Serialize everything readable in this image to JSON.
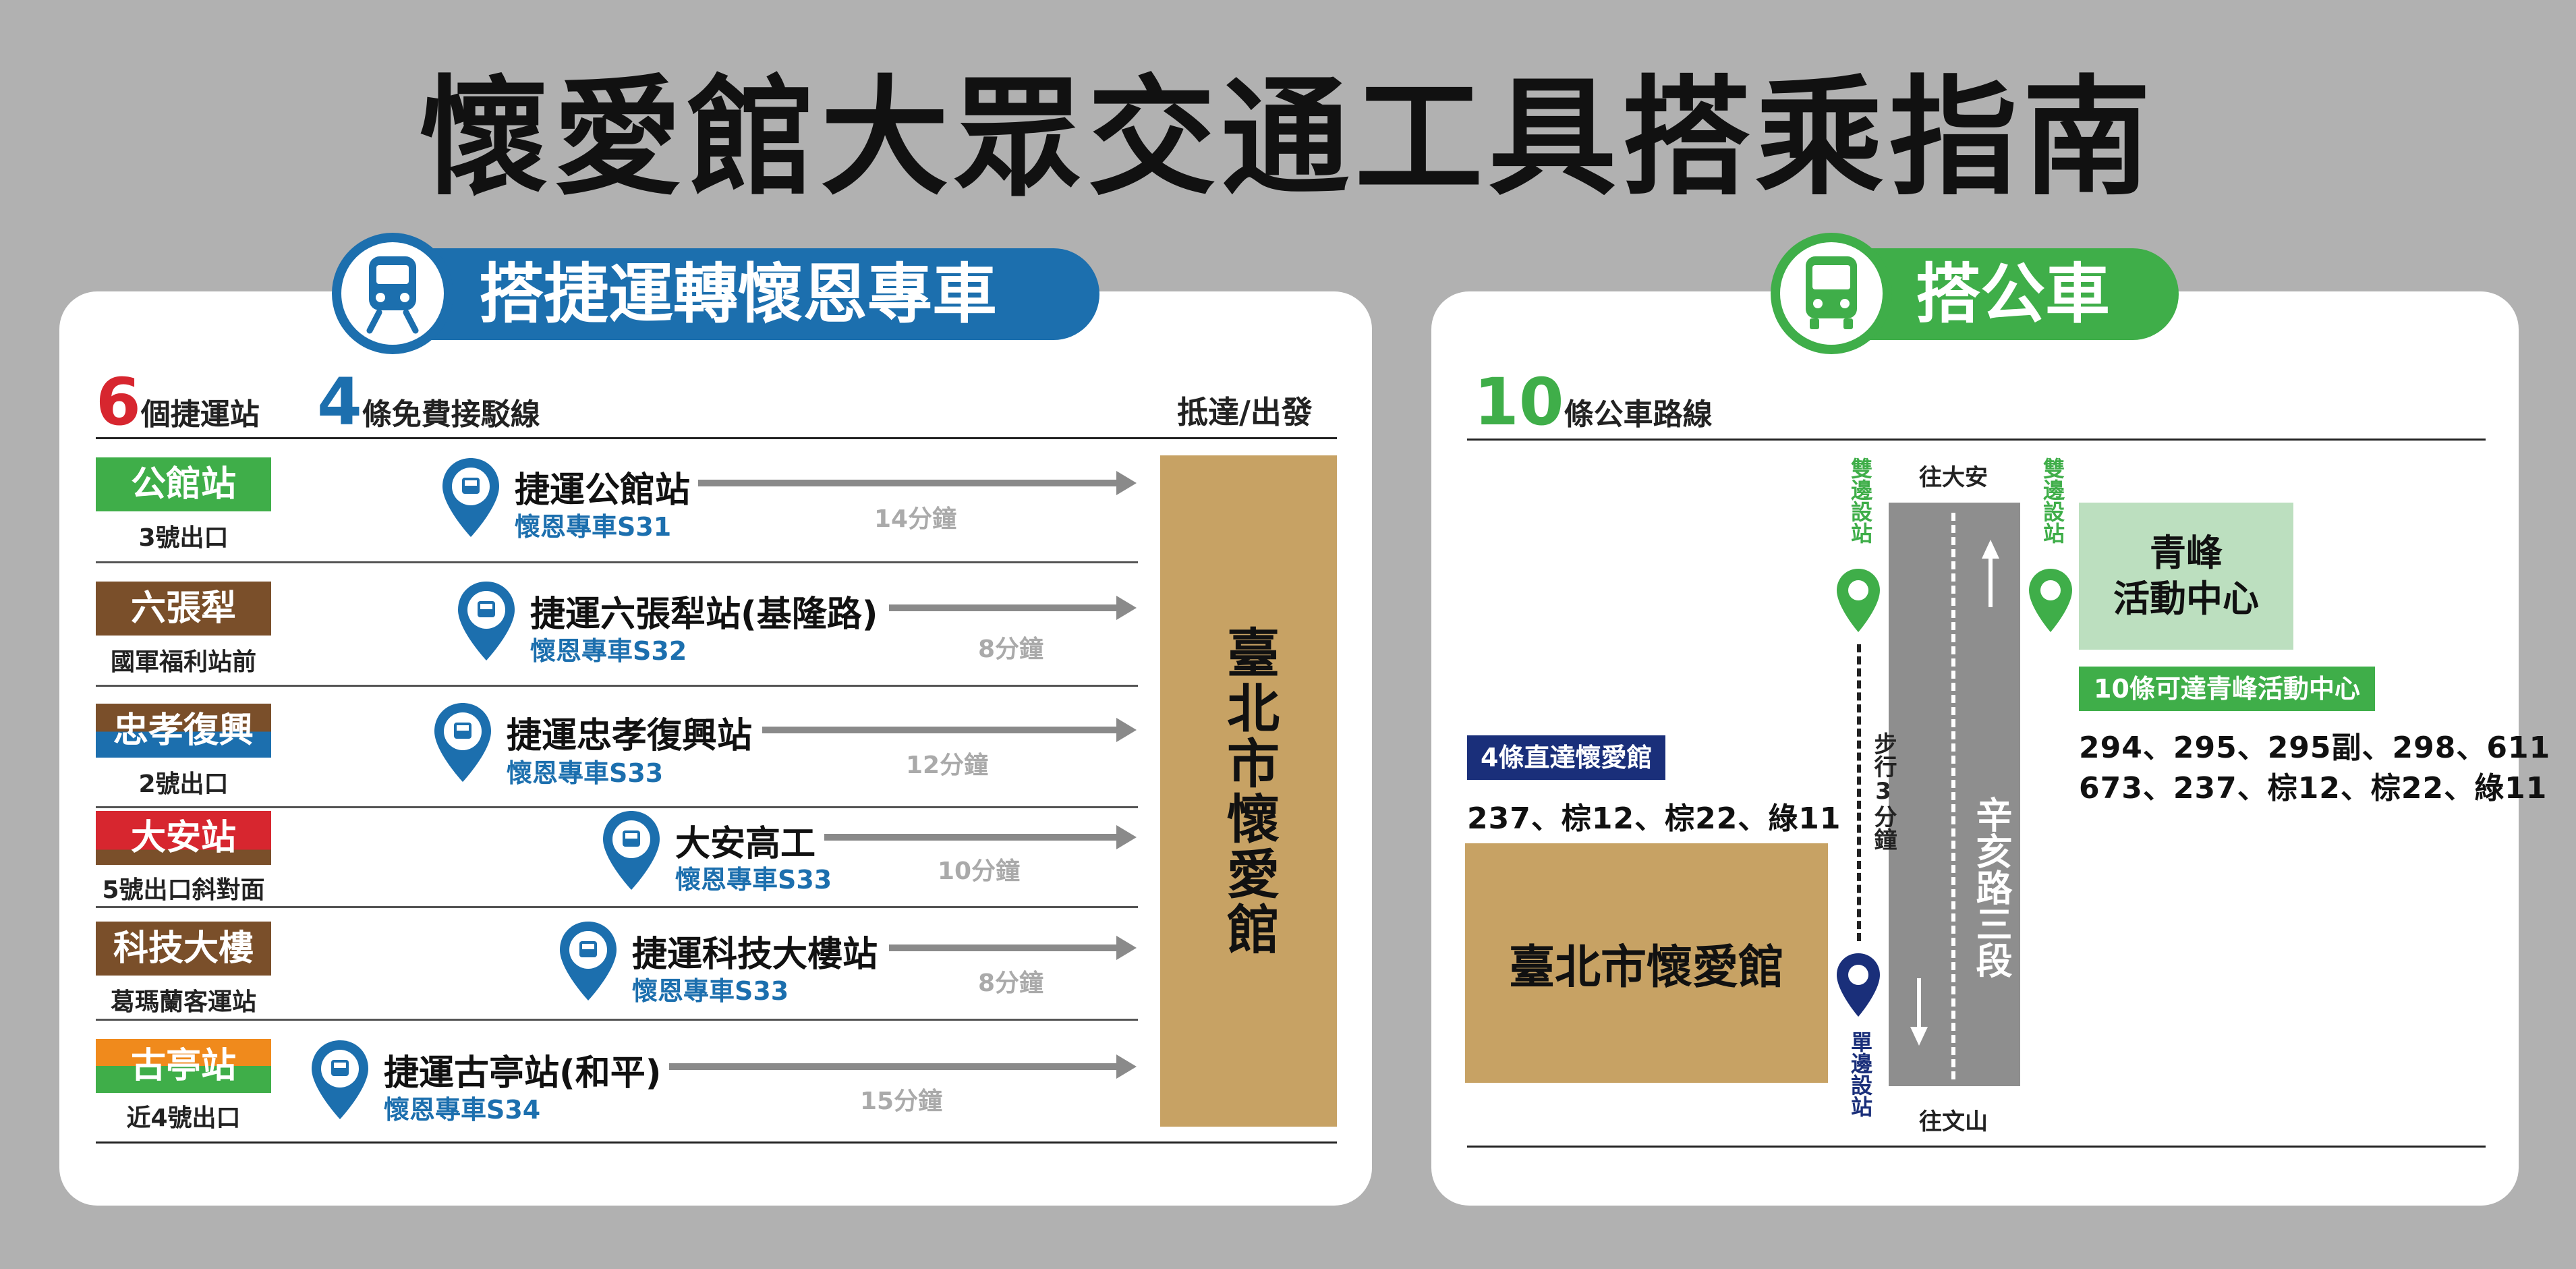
{
  "title": "懷愛館大眾交通工具搭乘指南",
  "colors": {
    "background": "#b1b1b1",
    "mrt_blue": "#1c6fae",
    "bus_green": "#3fae49",
    "text_dark": "#111111",
    "destination_tan": "#c7a264",
    "sidewalk_green": "#bcdfbf",
    "navy": "#1a2f7a",
    "grey_arrow": "#8a8a8a"
  },
  "mrt": {
    "header_label": "搭捷運轉懷恩專車",
    "icon": "train-icon",
    "count_stations": "6",
    "stations_label": "個捷運站",
    "count_lines": "4",
    "lines_label": "條免費接駁線",
    "arrive_label": "抵達/出發",
    "destination": "臺北市懷愛館",
    "rows": [
      {
        "station": "公館站",
        "exit": "3號出口",
        "stop": "捷運公館站",
        "route": "懷恩專車S31",
        "minutes": "14分鐘",
        "tag_color": "#3fae49",
        "tag_color2": ""
      },
      {
        "station": "六張犁",
        "exit": "國軍福利站前",
        "stop": "捷運六張犁站(基隆路)",
        "route": "懷恩專車S32",
        "minutes": "8分鐘",
        "tag_color": "#7a4f2a",
        "tag_color2": ""
      },
      {
        "station": "忠孝復興",
        "exit": "2號出口",
        "stop": "捷運忠孝復興站",
        "route": "懷恩專車S33",
        "minutes": "12分鐘",
        "tag_color": "#7a4f2a",
        "tag_color2": "#1c6fae"
      },
      {
        "station": "大安站",
        "exit": "5號出口斜對面",
        "stop": "大安高工",
        "route": "懷恩專車S33",
        "minutes": "10分鐘",
        "tag_color": "#d7262f",
        "tag_color2": "#7a4f2a"
      },
      {
        "station": "科技大樓",
        "exit": "葛瑪蘭客運站",
        "stop": "捷運科技大樓站",
        "route": "懷恩專車S33",
        "minutes": "8分鐘",
        "tag_color": "#7a4f2a",
        "tag_color2": ""
      },
      {
        "station": "古亭站",
        "exit": "近4號出口",
        "stop": "捷運古亭站(和平)",
        "route": "懷恩專車S34",
        "minutes": "15分鐘",
        "tag_color": "#f08a1c",
        "tag_color2": "#3fae49"
      }
    ]
  },
  "bus": {
    "header_label": "搭公車",
    "icon": "bus-icon",
    "count_routes": "10",
    "routes_label": "條公車路線",
    "both_sides_left": "雙邊設站",
    "both_sides_right": "雙邊設站",
    "one_side": "單邊設站",
    "to_daan": "往大安",
    "to_wenshan": "往文山",
    "road_name": "辛亥路三段",
    "walk_label": "步行3分鐘",
    "center_name_line1": "青峰",
    "center_name_line2": "活動中心",
    "center_badge": "10條可達青峰活動中心",
    "center_routes_line1": "294、295、295副、298、611",
    "center_routes_line2": "673、237、棕12、棕22、綠11",
    "direct_badge": "4條直達懷愛館",
    "direct_routes": "237、棕12、棕22、綠11",
    "destination": "臺北市懷愛館"
  }
}
